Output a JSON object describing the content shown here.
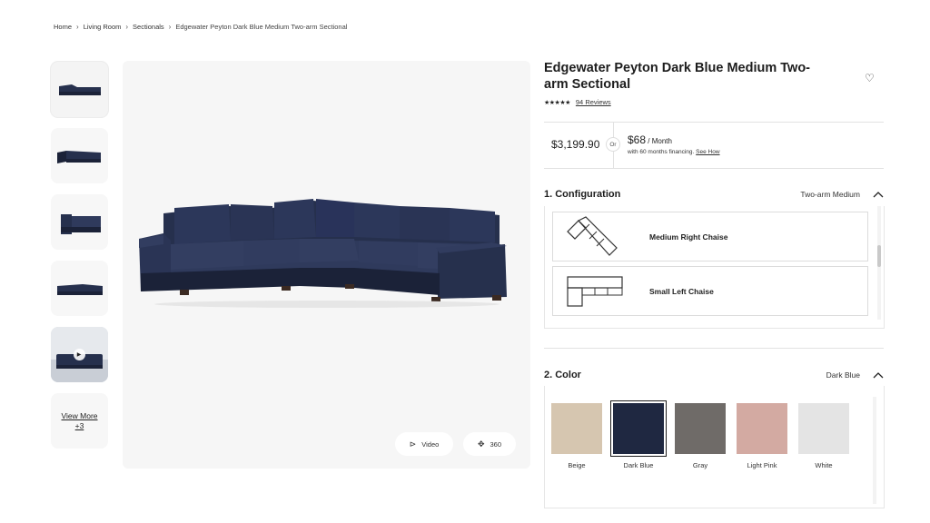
{
  "breadcrumb": {
    "items": [
      "Home",
      "Living Room",
      "Sectionals"
    ],
    "current": "Edgewater Peyton Dark Blue Medium Two-arm Sectional"
  },
  "gallery": {
    "view_more_label": "View More",
    "view_more_count": "+3",
    "video_button": "Video",
    "spin_button": "360"
  },
  "product": {
    "title": "Edgewater Peyton Dark Blue Medium Two-arm Sectional",
    "stars": "★★★★★",
    "reviews": "94 Reviews",
    "price": "$3,199.90",
    "or_label": "Or",
    "monthly_amount": "$68",
    "monthly_unit": " / Month",
    "financing_text": "with 60 months financing.",
    "financing_link": "See How"
  },
  "configuration": {
    "heading": "1. Configuration",
    "selected": "Two-arm Medium",
    "options": [
      "Medium Right Chaise",
      "Small Left Chaise"
    ]
  },
  "color": {
    "heading": "2. Color",
    "selected": "Dark Blue",
    "swatches": [
      {
        "name": "Beige",
        "hex": "#d6c6b0"
      },
      {
        "name": "Dark Blue",
        "hex": "#1f2841"
      },
      {
        "name": "Gray",
        "hex": "#6f6b68"
      },
      {
        "name": "Light Pink",
        "hex": "#d3aaa2"
      },
      {
        "name": "White",
        "hex": "#e4e4e4"
      }
    ]
  },
  "colors": {
    "sofa": "#26304d",
    "sofa_shadow": "#1b2238",
    "sofa_highlight": "#2f3a5c"
  }
}
